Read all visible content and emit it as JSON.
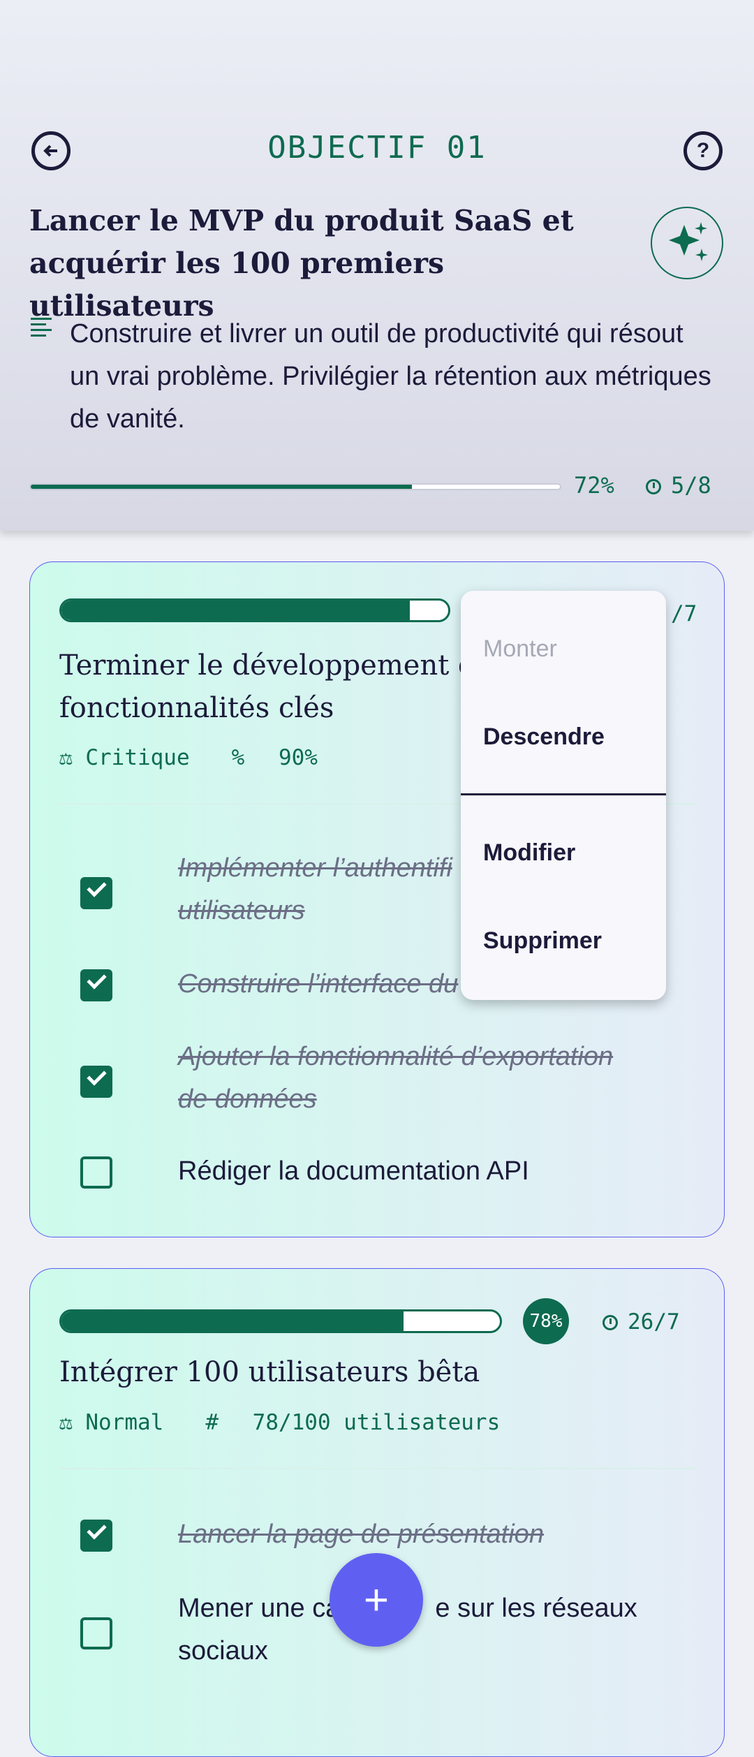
{
  "header": {
    "title": "OBJECTIF 01",
    "objective": "Lancer le MVP du produit SaaS et acquérir les 100 premiers utilisateurs",
    "description": "Construire et livrer un outil de productivité qui résout un vrai problème. Privilégier la rétention aux métriques de vanité.",
    "progress": 72,
    "progress_label": "72%",
    "count": "5/8",
    "icons": {
      "back": "back-arrow-icon",
      "help": "help-icon",
      "sparkle": "sparkle-icon",
      "description": "description-icon"
    }
  },
  "key_results": [
    {
      "progress": 90,
      "count": "/7",
      "title": "Terminer le développement des fonctionnalités clés",
      "title_visible": "Terminer le développement d",
      "title_line2": "fonctionnalités clés",
      "priority": "Critique",
      "metric_icon": "%",
      "metric": "90%",
      "tasks": [
        {
          "label": "Implémenter l’authentification des utilisateurs",
          "visible_line1": "Implémenter l’authentifi",
          "visible_line2": "utilisateurs",
          "done": true
        },
        {
          "label": "Construire l’interface du tableau de bord",
          "visible_line1": "Construire l’interface du",
          "done": true
        },
        {
          "label": "Ajouter la fonctionnalité d’exportation de données",
          "visible_line1": "Ajouter la fonctionnalité d’exportation",
          "visible_line2": "de données",
          "done": true
        },
        {
          "label": "Rédiger la documentation API",
          "done": false
        }
      ]
    },
    {
      "progress": 78,
      "progress_label": "78%",
      "count": "26/7",
      "title": "Intégrer 100 utilisateurs bêta",
      "priority": "Normal",
      "metric_icon": "#",
      "metric": "78/100 utilisateurs",
      "tasks": [
        {
          "label": "Lancer la page de présentation",
          "done": true
        },
        {
          "label": "Mener une campagne sur les réseaux sociaux",
          "visible_line1": "Mener une ca",
          "visible_line1b": "e sur les réseaux",
          "visible_line2": "sociaux",
          "done": false
        }
      ]
    }
  ],
  "menu": {
    "items": [
      "Monter",
      "Descendre",
      "Modifier",
      "Supprimer"
    ]
  },
  "fab": {
    "label": "+"
  },
  "colors": {
    "accent": "#0d6b50",
    "fab": "#5f60f2",
    "card_border": "#5b5cf0",
    "text": "#1c1b3a"
  }
}
